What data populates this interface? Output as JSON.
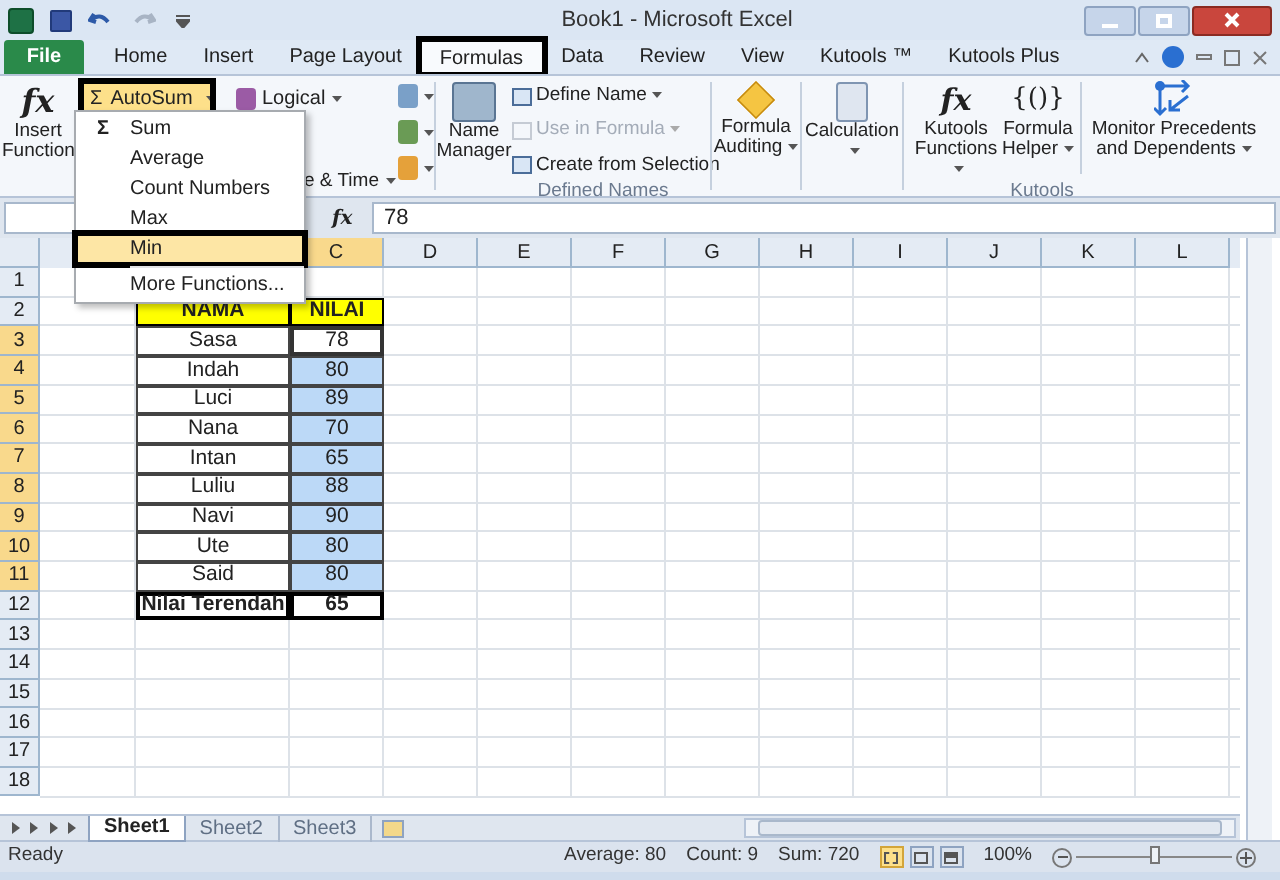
{
  "window": {
    "title": "Book1 - Microsoft Excel"
  },
  "tabs": [
    {
      "label": "File",
      "kind": "file",
      "selected": false,
      "annotated": false
    },
    {
      "label": "Home",
      "kind": "tab",
      "selected": false,
      "annotated": false
    },
    {
      "label": "Insert",
      "kind": "tab",
      "selected": false,
      "annotated": false
    },
    {
      "label": "Page Layout",
      "kind": "tab",
      "selected": false,
      "annotated": false
    },
    {
      "label": "Formulas",
      "kind": "tab",
      "selected": true,
      "annotated": true
    },
    {
      "label": "Data",
      "kind": "tab",
      "selected": false,
      "annotated": false
    },
    {
      "label": "Review",
      "kind": "tab",
      "selected": false,
      "annotated": false
    },
    {
      "label": "View",
      "kind": "tab",
      "selected": false,
      "annotated": false
    },
    {
      "label": "Kutools ™",
      "kind": "tab",
      "selected": false,
      "annotated": false
    },
    {
      "label": "Kutools Plus",
      "kind": "tab",
      "selected": false,
      "annotated": false
    }
  ],
  "ribbon": {
    "insert_function": {
      "icon_text": "fx",
      "label": "Insert Function"
    },
    "autosum": {
      "symbol": "Σ",
      "label": "AutoSum",
      "annotated": true
    },
    "logical": {
      "label": "Logical"
    },
    "date_time": {
      "label": "e & Time"
    },
    "name_manager": {
      "label": "Name Manager"
    },
    "defined_names": [
      {
        "label": "Define Name",
        "disabled": false,
        "dropdown": true
      },
      {
        "label": "Use in Formula",
        "disabled": true,
        "dropdown": true
      },
      {
        "label": "Create from Selection",
        "disabled": false,
        "dropdown": false
      }
    ],
    "defined_names_label": "Defined Names",
    "formula_auditing": {
      "label": "Formula Auditing"
    },
    "calculation": {
      "label": "Calculation"
    },
    "kutools_functions": {
      "icon_text": "fx",
      "label": "Kutools Functions"
    },
    "formula_helper": {
      "icon_text": "{()}",
      "label": "Formula Helper"
    },
    "monitor": {
      "label": "Monitor Precedents and Dependents"
    },
    "kutools_label": "Kutools"
  },
  "autosum_menu": {
    "items": [
      {
        "label": "Sum",
        "icon_text": "Σ",
        "kind": "item",
        "selected": false,
        "annotated": false
      },
      {
        "label": "Average",
        "kind": "item",
        "selected": false,
        "annotated": false
      },
      {
        "label": "Count Numbers",
        "kind": "item",
        "selected": false,
        "annotated": false
      },
      {
        "label": "Max",
        "kind": "item",
        "selected": false,
        "annotated": false
      },
      {
        "label": "Min",
        "kind": "item",
        "selected": true,
        "annotated": true
      },
      {
        "label": "More Functions...",
        "kind": "more",
        "selected": false,
        "annotated": false
      }
    ]
  },
  "formula_bar": {
    "fx": "fx",
    "value": "78"
  },
  "columns": [
    {
      "label": "C",
      "selected": true
    },
    {
      "label": "D",
      "selected": false
    },
    {
      "label": "E",
      "selected": false
    },
    {
      "label": "F",
      "selected": false
    },
    {
      "label": "G",
      "selected": false
    },
    {
      "label": "H",
      "selected": false
    },
    {
      "label": "I",
      "selected": false
    },
    {
      "label": "J",
      "selected": false
    },
    {
      "label": "K",
      "selected": false
    },
    {
      "label": "L",
      "selected": false
    }
  ],
  "rows": [
    {
      "number": "1",
      "kind": "empty",
      "selected": false
    },
    {
      "number": "2",
      "kind": "header",
      "selected": false,
      "name": "NAMA",
      "value": "NILAI"
    },
    {
      "number": "3",
      "kind": "data",
      "selected": true,
      "active": true,
      "name": "Sasa",
      "value": "78"
    },
    {
      "number": "4",
      "kind": "data",
      "selected": true,
      "active": false,
      "name": "Indah",
      "value": "80"
    },
    {
      "number": "5",
      "kind": "data",
      "selected": true,
      "active": false,
      "name": "Luci",
      "value": "89"
    },
    {
      "number": "6",
      "kind": "data",
      "selected": true,
      "active": false,
      "name": "Nana",
      "value": "70"
    },
    {
      "number": "7",
      "kind": "data",
      "selected": true,
      "active": false,
      "name": "Intan",
      "value": "65"
    },
    {
      "number": "8",
      "kind": "data",
      "selected": true,
      "active": false,
      "name": "Luliu",
      "value": "88"
    },
    {
      "number": "9",
      "kind": "data",
      "selected": true,
      "active": false,
      "name": "Navi",
      "value": "90"
    },
    {
      "number": "10",
      "kind": "data",
      "selected": true,
      "active": false,
      "name": "Ute",
      "value": "80"
    },
    {
      "number": "11",
      "kind": "data",
      "selected": true,
      "active": false,
      "name": "Said",
      "value": "80"
    },
    {
      "number": "12",
      "kind": "total",
      "selected": false,
      "name": "Nilai Terendah",
      "value": "65"
    },
    {
      "number": "13",
      "kind": "empty",
      "selected": false
    },
    {
      "number": "14",
      "kind": "empty",
      "selected": false
    },
    {
      "number": "15",
      "kind": "empty",
      "selected": false
    },
    {
      "number": "16",
      "kind": "empty",
      "selected": false
    },
    {
      "number": "17",
      "kind": "empty",
      "selected": false
    },
    {
      "number": "18",
      "kind": "empty",
      "selected": false
    }
  ],
  "sheets": [
    {
      "label": "Sheet1",
      "selected": true
    },
    {
      "label": "Sheet2",
      "selected": false
    },
    {
      "label": "Sheet3",
      "selected": false
    }
  ],
  "status_bar": {
    "mode": "Ready",
    "average": "Average: 80",
    "count": "Count: 9",
    "sum": "Sum: 720",
    "views": [
      {
        "kind": "normal",
        "selected": true
      },
      {
        "kind": "page-layout",
        "selected": false
      },
      {
        "kind": "page-break",
        "selected": false
      }
    ],
    "zoom": "100%",
    "zoom_level": {
      "level": 0.5
    }
  }
}
